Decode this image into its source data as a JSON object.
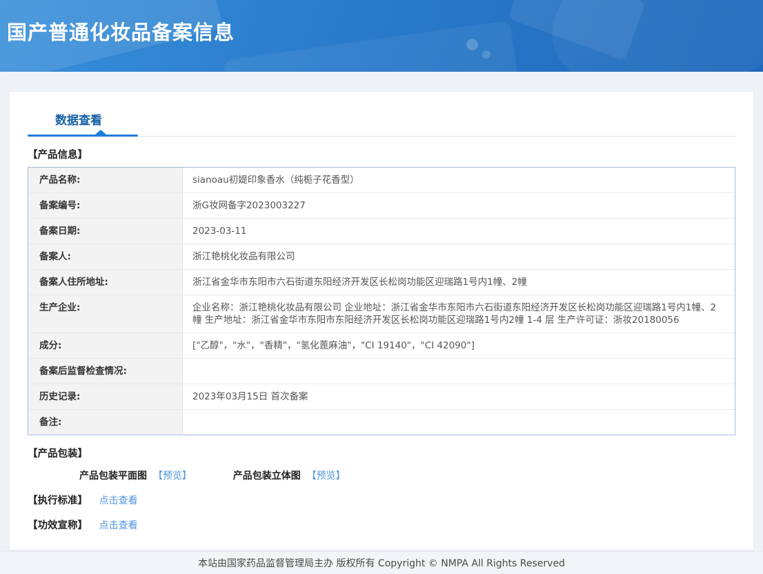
{
  "header": {
    "title": "国产普通化妆品备案信息"
  },
  "tabs": {
    "data_view_label": "数据查看"
  },
  "product_info": {
    "section_title": "【产品信息】",
    "rows": [
      {
        "label": "产品名称:",
        "value": "sianoau初媞印象香水（纯栀子花香型）"
      },
      {
        "label": "备案编号:",
        "value": "浙G妆网备字2023003227"
      },
      {
        "label": "备案日期:",
        "value": "2023-03-11"
      },
      {
        "label": "备案人:",
        "value": "浙江艳桃化妆品有限公司"
      },
      {
        "label": "备案人住所地址:",
        "value": "浙江省金华市东阳市六石街道东阳经济开发区长松岗功能区迎瑞路1号内1幢、2幢"
      },
      {
        "label": "生产企业:",
        "value": "企业名称：浙江艳桃化妆品有限公司 企业地址：浙江省金华市东阳市六石街道东阳经济开发区长松岗功能区迎瑞路1号内1幢、2幢 生产地址：浙江省金华市东阳市东阳经济开发区长松岗功能区迎瑞路1号内2幢 1-4 层 生产许可证：浙妆20180056"
      },
      {
        "label": "成分:",
        "value": "[\"乙醇\"，\"水\"，\"香精\"，\"氢化蓖麻油\"，\"CI 19140\"，\"CI 42090\"]"
      },
      {
        "label": "备案后监督检查情况:",
        "value": ""
      },
      {
        "label": "历史记录:",
        "value": "2023年03月15日 首次备案"
      },
      {
        "label": "备注:",
        "value": ""
      }
    ]
  },
  "packaging": {
    "section_title": "【产品包装】",
    "items": [
      {
        "label": "产品包装平面图",
        "link_text": "【预览】"
      },
      {
        "label": "产品包装立体图",
        "link_text": "【预览】"
      }
    ]
  },
  "execution_standard": {
    "title": "【执行标准】",
    "link_text": "点击查看"
  },
  "efficacy_claim": {
    "title": "【功效宣称】",
    "link_text": "点击查看"
  },
  "footer": {
    "text": "本站由国家药品监督管理局主办 版权所有 Copyright © NMPA All Rights Reserved"
  },
  "colors": {
    "header_gradient_start": "#3990da",
    "header_gradient_end": "#1f68ba",
    "tab_text": "#1460a5",
    "tab_underline": "#1e7ed8",
    "link_blue": "#4e96dc",
    "table_border": "#a4bcda",
    "label_cell_bg": "#f3f3f3"
  }
}
